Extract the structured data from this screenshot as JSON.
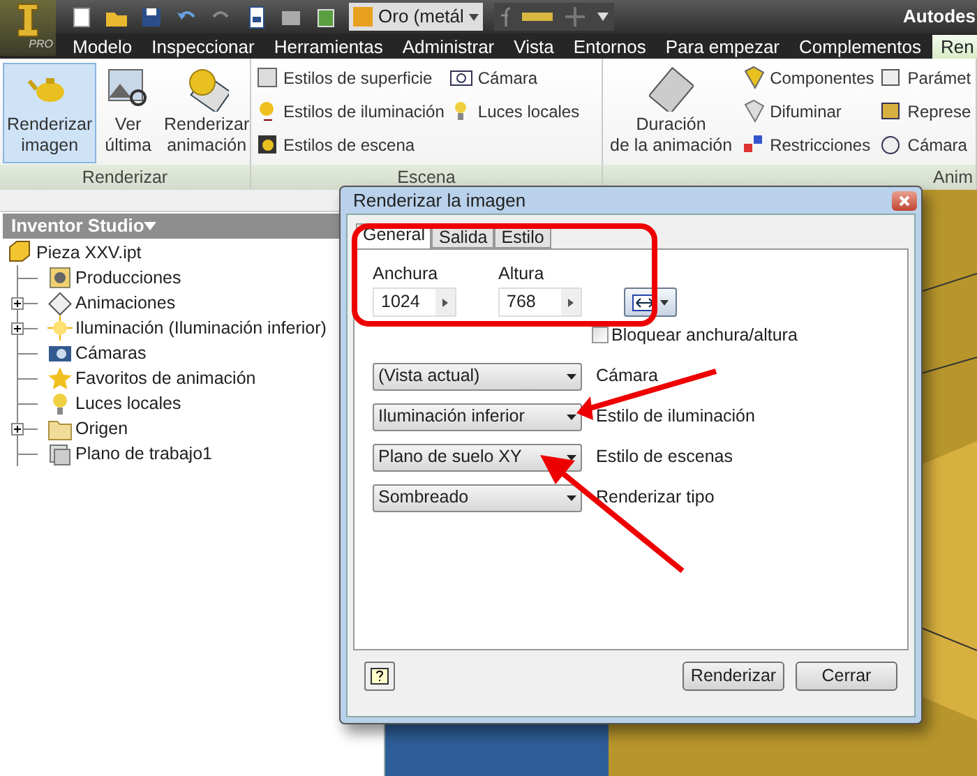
{
  "app": {
    "badge": "PRO",
    "title": "Autodes"
  },
  "quick_access": {
    "material": "Oro (metál"
  },
  "tabs": [
    {
      "label": "Modelo",
      "selected": false
    },
    {
      "label": "Inspeccionar",
      "selected": false
    },
    {
      "label": "Herramientas",
      "selected": false
    },
    {
      "label": "Administrar",
      "selected": false
    },
    {
      "label": "Vista",
      "selected": false
    },
    {
      "label": "Entornos",
      "selected": false
    },
    {
      "label": "Para empezar",
      "selected": false
    },
    {
      "label": "Complementos",
      "selected": false
    },
    {
      "label": "Ren",
      "selected": true
    }
  ],
  "ribbon": {
    "groups": [
      {
        "label": "Renderizar",
        "large": [
          {
            "label": "Renderizar imagen",
            "selected": true
          },
          {
            "label": "Ver última",
            "selected": false
          },
          {
            "label": "Renderizar animación",
            "selected": false
          }
        ]
      },
      {
        "label": "Escena",
        "small": [
          {
            "label": "Estilos de superficie"
          },
          {
            "label": "Estilos de iluminación"
          },
          {
            "label": "Estilos de escena"
          },
          {
            "label": "Cámara"
          },
          {
            "label": "Luces locales"
          }
        ]
      },
      {
        "label": "Anim",
        "large": [
          {
            "label": "Duración de la animación",
            "selected": false
          }
        ],
        "small": [
          {
            "label": "Componentes"
          },
          {
            "label": "Difuminar"
          },
          {
            "label": "Restricciones"
          },
          {
            "label": "Parámet"
          },
          {
            "label": "Represe"
          },
          {
            "label": "Cámara"
          }
        ]
      }
    ]
  },
  "browser": {
    "title": "Inventor Studio",
    "tree": [
      {
        "label": "Pieza XXV.ipt",
        "kind": "part",
        "children": [
          {
            "label": "Producciones",
            "kind": "productions",
            "collapsible": false
          },
          {
            "label": "Animaciones",
            "kind": "animations",
            "collapsible": true
          },
          {
            "label": "Iluminación (Iluminación inferior)",
            "kind": "lighting",
            "collapsible": true
          },
          {
            "label": "Cámaras",
            "kind": "cameras",
            "collapsible": false
          },
          {
            "label": "Favoritos de animación",
            "kind": "favorites",
            "collapsible": false
          },
          {
            "label": "Luces locales",
            "kind": "bulb",
            "collapsible": false
          },
          {
            "label": "Origen",
            "kind": "folder",
            "collapsible": true
          },
          {
            "label": "Plano de trabajo1",
            "kind": "plane",
            "collapsible": false
          }
        ]
      }
    ]
  },
  "dialog": {
    "title": "Renderizar la imagen",
    "tabs": [
      {
        "label": "General",
        "selected": true
      },
      {
        "label": "Salida",
        "selected": false
      },
      {
        "label": "Estilo",
        "selected": false
      }
    ],
    "size": [
      {
        "label": "Anchura",
        "value": "1024"
      },
      {
        "label": "Altura",
        "value": "768"
      }
    ],
    "lock": {
      "label": "Bloquear anchura/altura",
      "checked": false
    },
    "dropdowns": [
      {
        "value": "(Vista actual)",
        "label": "Cámara"
      },
      {
        "value": "Iluminación inferior",
        "label": "Estilo de iluminación"
      },
      {
        "value": "Plano de suelo XY",
        "label": "Estilo de escenas"
      },
      {
        "value": "Sombreado",
        "label": "Renderizar tipo"
      }
    ],
    "buttons": [
      "Renderizar",
      "Cerrar"
    ]
  }
}
